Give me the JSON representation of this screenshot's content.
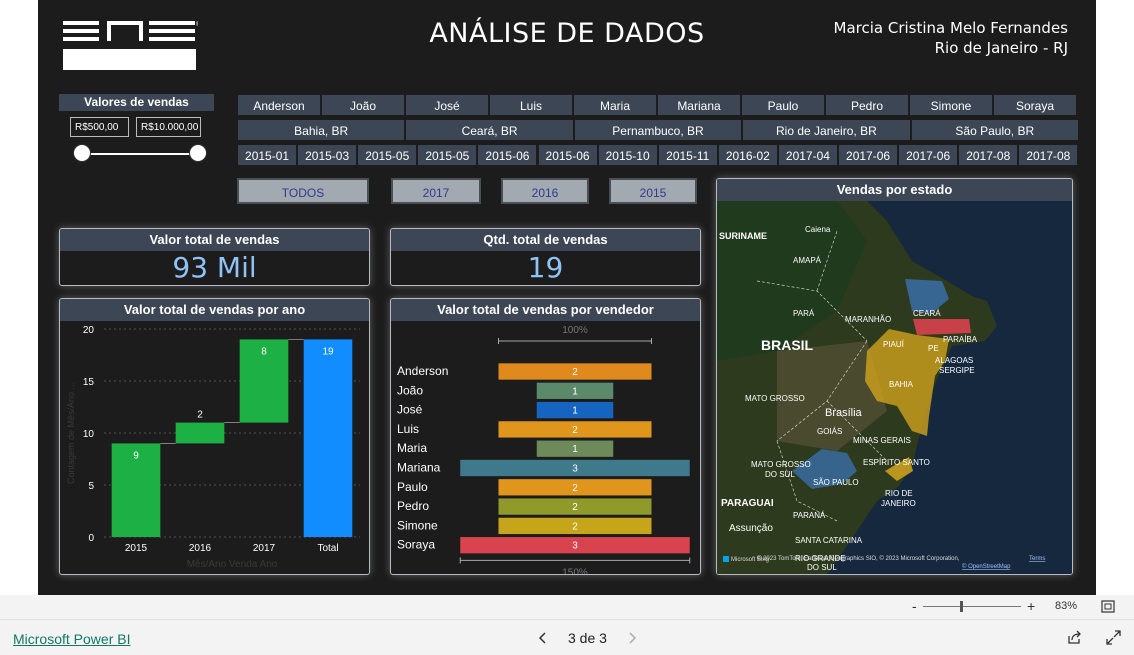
{
  "header": {
    "title": "ANÁLISE DE DADOS",
    "author": "Marcia Cristina Melo Fernandes",
    "location": "Rio de Janeiro - RJ"
  },
  "logo": {
    "name": "ENS",
    "registered": "®"
  },
  "value_slicer": {
    "title": "Valores de vendas",
    "min_value": "R$500,00",
    "max_value": "R$10.000,00"
  },
  "filters": {
    "sellers": [
      "Anderson",
      "João",
      "José",
      "Luis",
      "Maria",
      "Mariana",
      "Paulo",
      "Pedro",
      "Simone",
      "Soraya"
    ],
    "states": [
      "Bahia, BR",
      "Ceará, BR",
      "Pernambuco, BR",
      "Rio de Janeiro, BR",
      "São Paulo, BR"
    ],
    "months": [
      "2015-01",
      "2015-03",
      "2015-05",
      "2015-05",
      "2015-06",
      "2015-06",
      "2015-10",
      "2015-11",
      "2016-02",
      "2017-04",
      "2017-06",
      "2017-06",
      "2017-08",
      "2017-08"
    ],
    "years": [
      "TODOS",
      "2017",
      "2016",
      "2015"
    ]
  },
  "kpis": {
    "total_value_title": "Valor total de vendas",
    "total_value": "93 Mil",
    "total_qty_title": "Qtd. total de vendas",
    "total_qty": "19"
  },
  "chart_data": [
    {
      "type": "bar",
      "subtype": "waterfall",
      "title": "Valor total de vendas por ano",
      "xlabel": "Mês/Ano Venda Ano",
      "ylabel": "Contagem de Mês/Ano ...",
      "categories": [
        "2015",
        "2016",
        "2017",
        "Total"
      ],
      "values": [
        9,
        2,
        8,
        19
      ],
      "ylim": [
        0,
        20
      ],
      "yticks": [
        0,
        5,
        10,
        15,
        20
      ],
      "grid": true,
      "colors": {
        "increase": "#1db045",
        "total": "#118dff"
      }
    },
    {
      "type": "bar",
      "subtype": "funnel",
      "title": "Valor total de vendas por vendedor",
      "categories": [
        "Anderson",
        "João",
        "José",
        "Luis",
        "Maria",
        "Mariana",
        "Paulo",
        "Pedro",
        "Simone",
        "Soraya"
      ],
      "values": [
        2,
        1,
        1,
        2,
        1,
        3,
        2,
        2,
        2,
        3
      ],
      "top_label": "100%",
      "bottom_label": "150%",
      "colors": [
        "#e08a1e",
        "#5b8a6a",
        "#1565c0",
        "#e0951c",
        "#6d8a5a",
        "#3f7a8c",
        "#e0951c",
        "#8f9a2a",
        "#c7a51a",
        "#d9434e"
      ]
    }
  ],
  "map": {
    "title": "Vendas por estado",
    "labels": [
      "SURINAME",
      "Caiena",
      "AMAPÁ",
      "PARÁ",
      "MARANHÃO",
      "CEARÁ",
      "PARAÍBA",
      "PIAUÍ",
      "PE",
      "ALAGOAS",
      "SERGIPE",
      "BRASIL",
      "BAHIA",
      "MATO GROSSO",
      "Brasília",
      "GOIÁS",
      "MINAS GERAIS",
      "ESPÍRITO SANTO",
      "MATO GROSSO DO SUL",
      "SÃO PAULO",
      "RIO DE JANEIRO",
      "PARAGUAI",
      "PARANÁ",
      "Assunção",
      "SANTA CATARINA",
      "RIO GRANDE DO SUL"
    ],
    "attribution": "© 2023 TomTom, Earthstar Geographics SIO, © 2023 Microsoft Corporation,",
    "terms": "Terms",
    "osm": "© OpenStreetMap",
    "bing": "Microsoft Bing",
    "colors": {
      "ceara": "#3a6fa8",
      "pernambuco": "#d9434e",
      "bahia": "#d4a51c",
      "sao_paulo": "#3a6fa8",
      "rio": "#d4a51c"
    }
  },
  "statusbar": {
    "zoom_minus": "-",
    "zoom_plus": "+",
    "zoom": "83%"
  },
  "footer": {
    "powerbi_link": "Microsoft Power BI",
    "page": "3 de 3"
  }
}
